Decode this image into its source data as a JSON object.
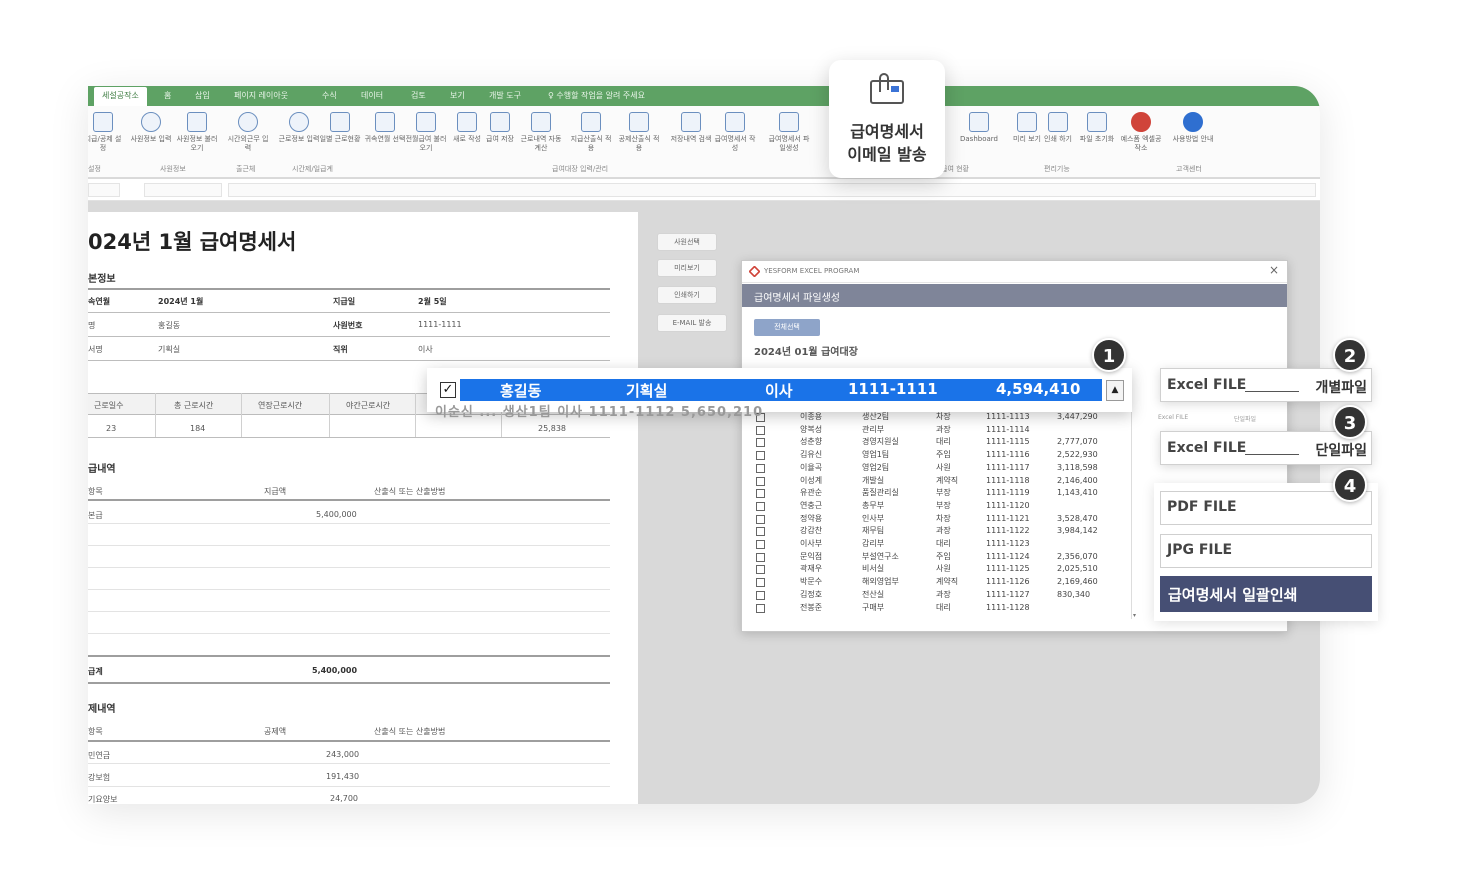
{
  "tabs": [
    "세설공작소",
    "홈",
    "삽입",
    "페이지 레이아웃",
    "수식",
    "데이터",
    "검토",
    "보기",
    "개발 도구",
    "♀ 수행할 작업을 알려 주세요"
  ],
  "ribbon": {
    "buttons": [
      {
        "label": "지급/공제 설정",
        "icon": "settings-doc-icon"
      },
      {
        "label": "사원정보 입력",
        "icon": "users-icon"
      },
      {
        "label": "사원정보 불러오기",
        "icon": "users-import-icon"
      },
      {
        "label": "시간외근무 입력",
        "icon": "pie-clock-icon"
      },
      {
        "label": "근로정보 입력",
        "icon": "clock-icon"
      },
      {
        "label": "일별 근로현황",
        "icon": "calendar-icon"
      },
      {
        "label": "귀속연월 선택",
        "icon": "calendar-select-icon"
      },
      {
        "label": "전월급여 불러오기",
        "icon": "import-doc-icon"
      },
      {
        "label": "새로 작성",
        "icon": "new-doc-icon"
      },
      {
        "label": "급여 저장",
        "icon": "save-doc-icon"
      },
      {
        "label": "근로내역 자동계산",
        "icon": "table-calc-icon"
      },
      {
        "label": "지급산출식 적용",
        "icon": "pen-formula-icon"
      },
      {
        "label": "공제산출식 적용",
        "icon": "pen-formula2-icon"
      },
      {
        "label": "저장내역 검색",
        "icon": "search-doc-icon"
      },
      {
        "label": "급여명세서 작성",
        "icon": "edit-doc-icon"
      },
      {
        "label": "급여명세서 파일생성",
        "icon": "file-create-icon"
      },
      {
        "label": "Dashboard",
        "icon": "dashboard-icon"
      },
      {
        "label": "미리 보기",
        "icon": "preview-icon"
      },
      {
        "label": "인쇄 하기",
        "icon": "printer-icon"
      },
      {
        "label": "파일 초기화",
        "icon": "reset-file-icon"
      },
      {
        "label": "예스폼 엑셀공작소",
        "icon": "yesform-logo-icon"
      },
      {
        "label": "사용방법 안내",
        "icon": "info-icon"
      }
    ],
    "groups": [
      "설정",
      "사원정보",
      "출근체",
      "시간제/일급계",
      "급여대장 입력/관리",
      "급여 현황",
      "편리기능",
      "고객센터"
    ]
  },
  "email_card": {
    "line1": "급여명세서",
    "line2": "이메일 발송"
  },
  "sheet": {
    "title": "024년 1월 급여명세서",
    "basic": {
      "section": "본정보",
      "rows": [
        {
          "k1": "속연월",
          "v1": "2024년 1월",
          "k2": "지급일",
          "v2": "2월 5일"
        },
        {
          "k1": "명",
          "v1": "홍길동",
          "k2": "사원번호",
          "v2": "1111-1111"
        },
        {
          "k1": "서명",
          "v1": "기획실",
          "k2": "직위",
          "v2": "이사"
        }
      ]
    },
    "work": {
      "headers": [
        "근로일수",
        "총 근로시간",
        "연장근로시간",
        "야간근로시간"
      ],
      "values": [
        "23",
        "184"
      ],
      "amount": "25,838"
    },
    "pay": {
      "section": "급내역",
      "h1": "항목",
      "h2": "지급액",
      "h3": "산출식 또는 산출방법",
      "item": "본급",
      "amount": "5,400,000",
      "total_label": "급계",
      "total": "5,400,000"
    },
    "ded": {
      "section": "제내역",
      "h1": "항목",
      "h2": "공제액",
      "h3": "산출식 또는 산출방법",
      "rows": [
        {
          "k": "민연금",
          "v": "243,000"
        },
        {
          "k": "강보험",
          "v": "191,430"
        },
        {
          "k": "기요양보",
          "v": "24,700"
        }
      ]
    }
  },
  "side_buttons": [
    "사원선택",
    "미리보기",
    "인쇄하기",
    "E-MAIL 발송"
  ],
  "dialog": {
    "brand": "YESFORM EXCEL PROGRAM",
    "close": "×",
    "bar": "급여명세서 파일생성",
    "select_all": "전체선택",
    "ledger": "2024년 01월 급여대장",
    "rows": [
      [
        "이종용",
        "생산2팀",
        "차장",
        "1111-1113",
        "3,447,290"
      ],
      [
        "양복성",
        "관리부",
        "과장",
        "1111-1114",
        ""
      ],
      [
        "성춘향",
        "경영지원실",
        "대리",
        "1111-1115",
        "2,777,070"
      ],
      [
        "김유신",
        "영업1팀",
        "주임",
        "1111-1116",
        "2,522,930"
      ],
      [
        "이율곡",
        "영업2팀",
        "사원",
        "1111-1117",
        "3,118,598"
      ],
      [
        "이성계",
        "개발실",
        "계약직",
        "1111-1118",
        "2,146,400"
      ],
      [
        "유관순",
        "품질관리실",
        "부장",
        "1111-1119",
        "1,143,410"
      ],
      [
        "연충근",
        "총무부",
        "부장",
        "1111-1120",
        ""
      ],
      [
        "정약용",
        "인사부",
        "차장",
        "1111-1121",
        "3,528,470"
      ],
      [
        "강감찬",
        "재무팀",
        "과장",
        "1111-1122",
        "3,984,142"
      ],
      [
        "이사부",
        "감리부",
        "대리",
        "1111-1123",
        ""
      ],
      [
        "문익점",
        "부설연구소",
        "주임",
        "1111-1124",
        "2,356,070"
      ],
      [
        "곽재우",
        "비서실",
        "사원",
        "1111-1125",
        "2,025,510"
      ],
      [
        "박문수",
        "해외영업부",
        "계약직",
        "1111-1126",
        "2,169,460"
      ],
      [
        "김정호",
        "전산실",
        "과장",
        "1111-1127",
        "830,340"
      ],
      [
        "전봉준",
        "구매부",
        "대리",
        "1111-1128",
        ""
      ]
    ]
  },
  "highlight": {
    "check": "✓",
    "name": "홍길동",
    "dept": "기획실",
    "pos": "이사",
    "id": "1111-1111",
    "amount": "4,594,410",
    "ghost": "이순신 ...     생산1팀     이사     1111-1112     5,650,210",
    "arrow": "▲"
  },
  "options": [
    {
      "left": "Excel FILE",
      "right": "개별파일"
    },
    {
      "left": "Excel FILE",
      "right": "단일파일"
    }
  ],
  "option_tiny": [
    "Excel FILE",
    "단일파일"
  ],
  "plain_options": [
    "PDF FILE",
    "JPG FILE"
  ],
  "print_button": "급여명세서 일괄인쇄",
  "badges": [
    "1",
    "2",
    "3",
    "4"
  ],
  "colors": {
    "tab_green": "#5ea264",
    "selection_blue": "#1a73e8",
    "print_navy": "#464f74",
    "dialog_bar": "#7f8599"
  }
}
